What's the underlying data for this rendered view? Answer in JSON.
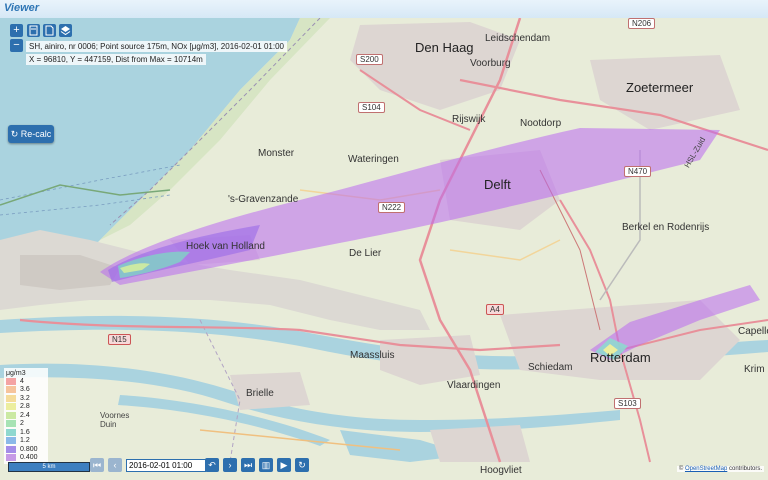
{
  "app": {
    "title": "Viewer"
  },
  "toolbar": {
    "zoom_in_label": "+",
    "zoom_out_label": "−",
    "calculator_icon": "calculator-icon",
    "document_icon": "document-icon",
    "layers_icon": "layers-icon"
  },
  "info": {
    "line1": "SH, ainiro, nr 0006; Point source 175m, NOx [μg/m3], 2016-02-01 01:00",
    "line2": "X = 96810, Y = 447159, Dist from Max = 10714m"
  },
  "recalc": {
    "label": "Re-calc",
    "icon": "refresh-icon"
  },
  "places": {
    "den_haag": "Den Haag",
    "leidschendam": "Leidschendam",
    "voorburg": "Voorburg",
    "zoetermeer": "Zoetermeer",
    "rijswijk": "Rijswijk",
    "nootdorp": "Nootdorp",
    "monster": "Monster",
    "wateringen": "Wateringen",
    "delft": "Delft",
    "gravenzande": "'s-Gravenzande",
    "hoek": "Hoek van Holland",
    "de_lier": "De Lier",
    "berkel": "Berkel en Rodenrijs",
    "maassluis": "Maassluis",
    "schiedam": "Schiedam",
    "rotterdam": "Rotterdam",
    "vlaardingen": "Vlaardingen",
    "brielle": "Brielle",
    "voornes": "Voornes Duin",
    "hoogvliet": "Hoogvliet",
    "capelle": "Capelle",
    "krim": "Krim"
  },
  "roads": {
    "s200": "S200",
    "s104": "S104",
    "n206": "N206",
    "n222": "N222",
    "n470": "N470",
    "n15": "N15",
    "a4": "A4",
    "s103": "S103",
    "hsl": "HSL-Zuid"
  },
  "legend": {
    "unit": "μg/m3",
    "entries": [
      {
        "label": "4",
        "color": "#f4a3a3"
      },
      {
        "label": "3.6",
        "color": "#f6c49c"
      },
      {
        "label": "3.2",
        "color": "#f5dc9a"
      },
      {
        "label": "2.8",
        "color": "#ecee9e"
      },
      {
        "label": "2.4",
        "color": "#cbe9a3"
      },
      {
        "label": "2",
        "color": "#a7e3b4"
      },
      {
        "label": "1.6",
        "color": "#8fd8cf"
      },
      {
        "label": "1.2",
        "color": "#8bb9e8"
      },
      {
        "label": "0.800",
        "color": "#a48de8"
      },
      {
        "label": "0.400",
        "color": "#c69ae6"
      }
    ]
  },
  "bottom": {
    "scale_label": "5 km",
    "date_value": "2016-02-01 01:00",
    "first_icon": "skip-first-icon",
    "prev_icon": "prev-icon",
    "next_icon": "next-icon",
    "last_icon": "skip-last-icon",
    "chart_icon": "chart-icon",
    "play_icon": "play-icon",
    "refresh_icon": "refresh-icon",
    "undo_icon": "rewind-icon"
  },
  "attribution": {
    "prefix": "©",
    "link": "OpenStreetMap",
    "suffix": "contributors."
  }
}
